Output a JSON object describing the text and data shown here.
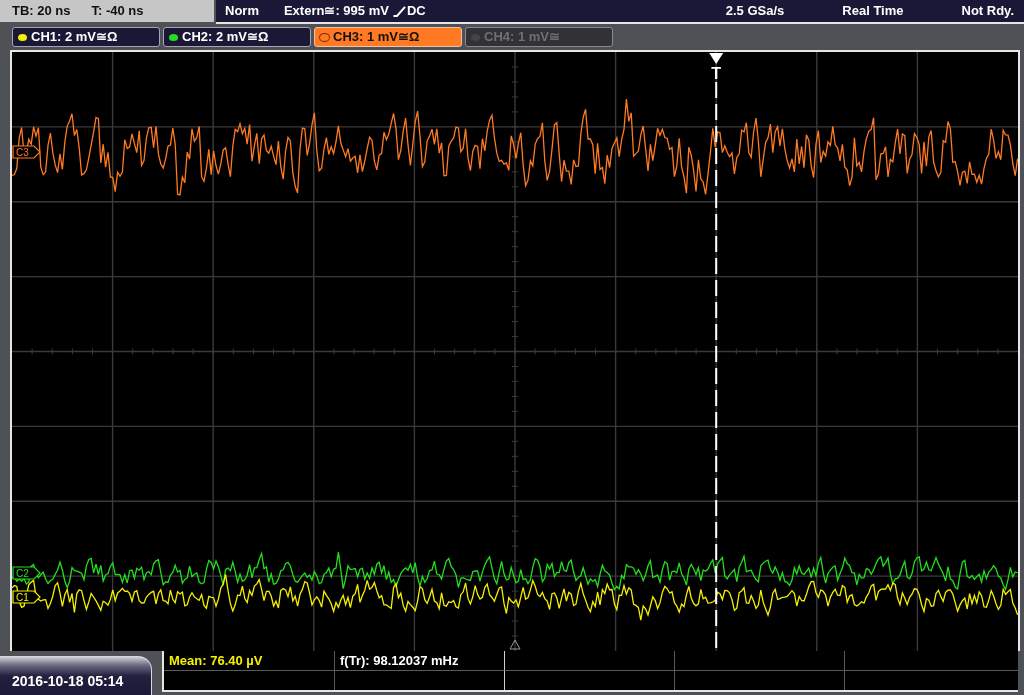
{
  "timebase": {
    "tb": "TB: 20 ns",
    "t": "T: -40 ns"
  },
  "trigger": {
    "mode": "Norm",
    "source": "Extern≅: 995 mV",
    "coupling": "DC",
    "marker": "T"
  },
  "acquisition": {
    "sample_rate": "2.5 GSa/s",
    "mode": "Real Time",
    "status": "Not Rdy."
  },
  "channels": [
    {
      "label": "CH1: 2 mV≅Ω",
      "color": "#f5f000",
      "on": true,
      "selected": false
    },
    {
      "label": "CH2: 2 mV≅Ω",
      "color": "#22e01e",
      "on": true,
      "selected": false
    },
    {
      "label": "CH3: 1 mV≅Ω",
      "color": "#ff7a22",
      "on": true,
      "selected": true
    },
    {
      "label": "CH4: 1 mV≅",
      "on": false,
      "selected": false
    }
  ],
  "traces": [
    {
      "marker": "C3",
      "color": "#ff7a22"
    },
    {
      "marker": "C2",
      "color": "#22e01e"
    },
    {
      "marker": "C1",
      "color": "#f5f000"
    }
  ],
  "measurements": [
    {
      "text": "Mean: 76.40 µV",
      "color": "#f5f000"
    },
    {
      "text": "f(Tr): 98.12037 mHz",
      "color": "#ffffff"
    }
  ],
  "datetime": "2016-10-18 05:14"
}
